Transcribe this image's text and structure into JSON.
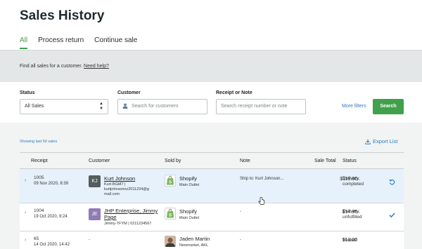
{
  "page": {
    "title": "Sales History"
  },
  "tabs": [
    {
      "label": "All",
      "active": true
    },
    {
      "label": "Process return",
      "active": false
    },
    {
      "label": "Continue sale",
      "active": false
    }
  ],
  "banner": {
    "text": "Find all sales for a customer.",
    "link": "Need help?"
  },
  "filters": {
    "status_label": "Status",
    "status_value": "All Sales",
    "customer_label": "Customer",
    "customer_placeholder": "Search for customers",
    "receipt_label": "Receipt or Note",
    "receipt_placeholder": "Search receipt number or note",
    "more_filters": "More filters",
    "search_button": "Search"
  },
  "list": {
    "showing": "Showing last 50 sales",
    "export": "Export List"
  },
  "table": {
    "columns": [
      "Receipt",
      "Customer",
      "Sold by",
      "Note",
      "Sale Total",
      "Status"
    ],
    "rows": [
      {
        "receipt": "1005",
        "date": "09 Nov 2020, 8:39",
        "avatar": "KJ",
        "avatar_color": "#555c5e",
        "customer": "Kurt Johnson",
        "customer_sub1": "Kurt-BGM7 |",
        "customer_sub2": "kurtjohnsonnz2011234@g",
        "customer_sub3": "mail.com",
        "seller": "Shopify",
        "seller_sub": "Main Outlet",
        "note": "Ship to: Kurt Johnson...",
        "total": "$119.60",
        "status1": "Delivery,",
        "status2": "completed",
        "action_icon": "return-icon"
      },
      {
        "receipt": "1004",
        "date": "19 Oct 2020, 9:24",
        "avatar": "JE",
        "avatar_color": "#8f7bb5",
        "customer": "JHP Enterprise, Jimmy",
        "customer_sub1": "Page",
        "customer_sub2": "Jimmy-TFYM | 0211234567",
        "seller": "Shopify",
        "seller_sub": "Main Outlet",
        "note": "-",
        "total": "$14.95",
        "status1": "Delivery,",
        "status2": "unfulfilled",
        "action_icon": "check-icon"
      },
      {
        "receipt": "65",
        "date": "14 Oct 2020, 14:42",
        "customer": "-",
        "seller": "Jaden Martin",
        "seller_sub": "Newmarket, AKL",
        "note": "-",
        "total": "$13.00",
        "status1": "Voided"
      }
    ]
  },
  "colors": {
    "accent": "#41a04b",
    "link": "#2f7cc1",
    "selected_row": "#e6f1fb"
  }
}
